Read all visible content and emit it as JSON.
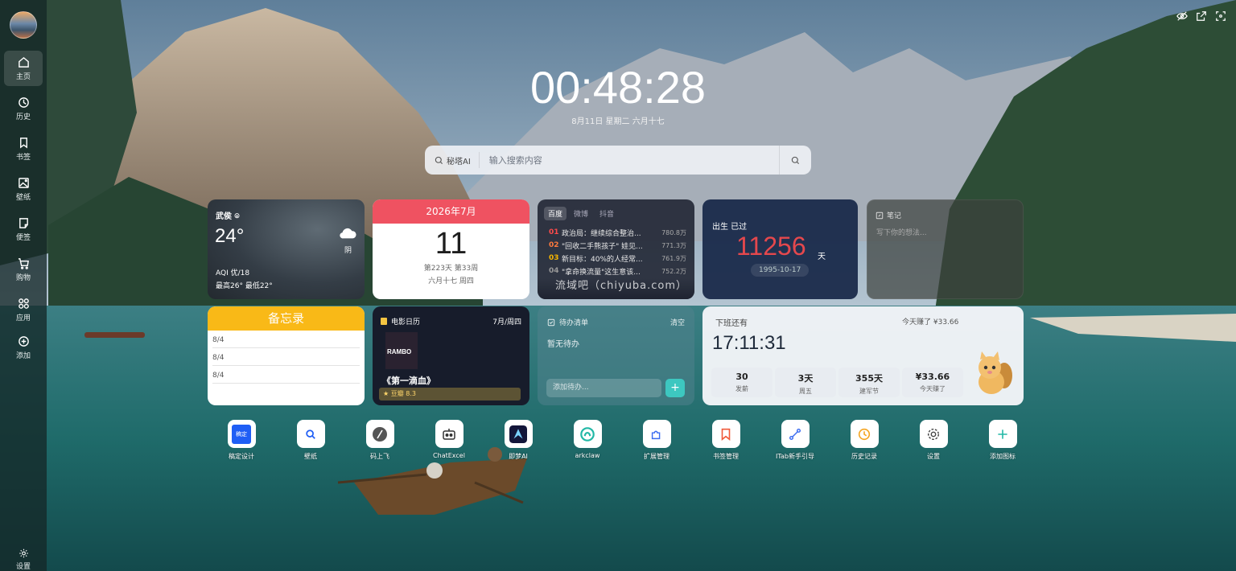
{
  "sidebar": {
    "items": [
      {
        "label": "主页",
        "icon": "home-icon",
        "active": true
      },
      {
        "label": "历史",
        "icon": "history-icon"
      },
      {
        "label": "书签",
        "icon": "bookmark-icon"
      },
      {
        "label": "壁纸",
        "icon": "image-icon"
      },
      {
        "label": "便签",
        "icon": "note-icon"
      },
      {
        "label": "购物",
        "icon": "cart-icon"
      },
      {
        "label": "应用",
        "icon": "apps-icon"
      },
      {
        "label": "添加",
        "icon": "plus-circle-icon"
      }
    ],
    "settings_label": "设置"
  },
  "clock": {
    "time": "00:48:28",
    "date": "8月11日 星期二 六月十七"
  },
  "search": {
    "engine": "秘塔AI",
    "placeholder": "输入搜索内容"
  },
  "weather": {
    "city": "武侯",
    "temp": "24°",
    "condition": "阴",
    "aqi": "AQI 优/18",
    "range": "最高26° 最低22°"
  },
  "calendar": {
    "month": "2026年7月",
    "day": "11",
    "week_info": "第223天 第33周",
    "lunar": "六月十七 周四"
  },
  "hotlist": {
    "tabs": [
      "百度",
      "微博",
      "抖音"
    ],
    "items": [
      {
        "rank": "01",
        "title": "政治局：继续综合整治...",
        "heat": "780.8万",
        "color": "#ff4b4b"
      },
      {
        "rank": "02",
        "title": "\"回收二手熊孩子\" 娃见...",
        "heat": "771.3万",
        "color": "#ff7a3d"
      },
      {
        "rank": "03",
        "title": "新目标：40%的人经常...",
        "heat": "761.9万",
        "color": "#f5b400"
      },
      {
        "rank": "04",
        "title": "\"拿命换流量\"这生意该...",
        "heat": "752.2万",
        "color": "#999999"
      }
    ],
    "watermark": "流域吧（chiyuba.com）"
  },
  "birth": {
    "label": "出生 已过",
    "days": "11256",
    "unit": "天",
    "date": "1995-10-17"
  },
  "note": {
    "title": "笔记",
    "placeholder": "写下你的想法..."
  },
  "memo": {
    "title": "备忘录",
    "lines": [
      "8/4",
      "8/4",
      "8/4"
    ]
  },
  "movie": {
    "title_label": "电影日历",
    "date": "7月/周四",
    "poster_text": "RAMBO",
    "name": "《第一滴血》",
    "rating": "★ 豆瓣 8.3"
  },
  "todo": {
    "title": "待办清单",
    "clear": "清空",
    "empty": "暂无待办",
    "placeholder": "添加待办...",
    "add": "+"
  },
  "offwork": {
    "label": "下班还有",
    "earned": "今天赚了 ¥33.66",
    "time": "17:11:31",
    "stats": [
      {
        "value": "30",
        "key": "发薪"
      },
      {
        "value": "3天",
        "key": "周五"
      },
      {
        "value": "355天",
        "key": "建军节"
      },
      {
        "value": "¥33.66",
        "key": "今天赚了"
      }
    ]
  },
  "apps": [
    {
      "label": "稿定设计",
      "icon": "gaoding-icon",
      "glyph": "稿定"
    },
    {
      "label": "壁纸",
      "icon": "search-icon"
    },
    {
      "label": "码上飞",
      "icon": "feather-icon"
    },
    {
      "label": "ChatExcel",
      "icon": "robot-icon"
    },
    {
      "label": "即梦AI",
      "icon": "jimeng-icon"
    },
    {
      "label": "arkclaw",
      "icon": "arkclaw-icon"
    },
    {
      "label": "扩展管理",
      "icon": "puzzle-icon"
    },
    {
      "label": "书签管理",
      "icon": "bookmark-icon"
    },
    {
      "label": "ITab新手引导",
      "icon": "route-icon"
    },
    {
      "label": "历史记录",
      "icon": "history-icon"
    },
    {
      "label": "设置",
      "icon": "gear-icon"
    },
    {
      "label": "添加图标",
      "icon": "plus-icon"
    }
  ]
}
